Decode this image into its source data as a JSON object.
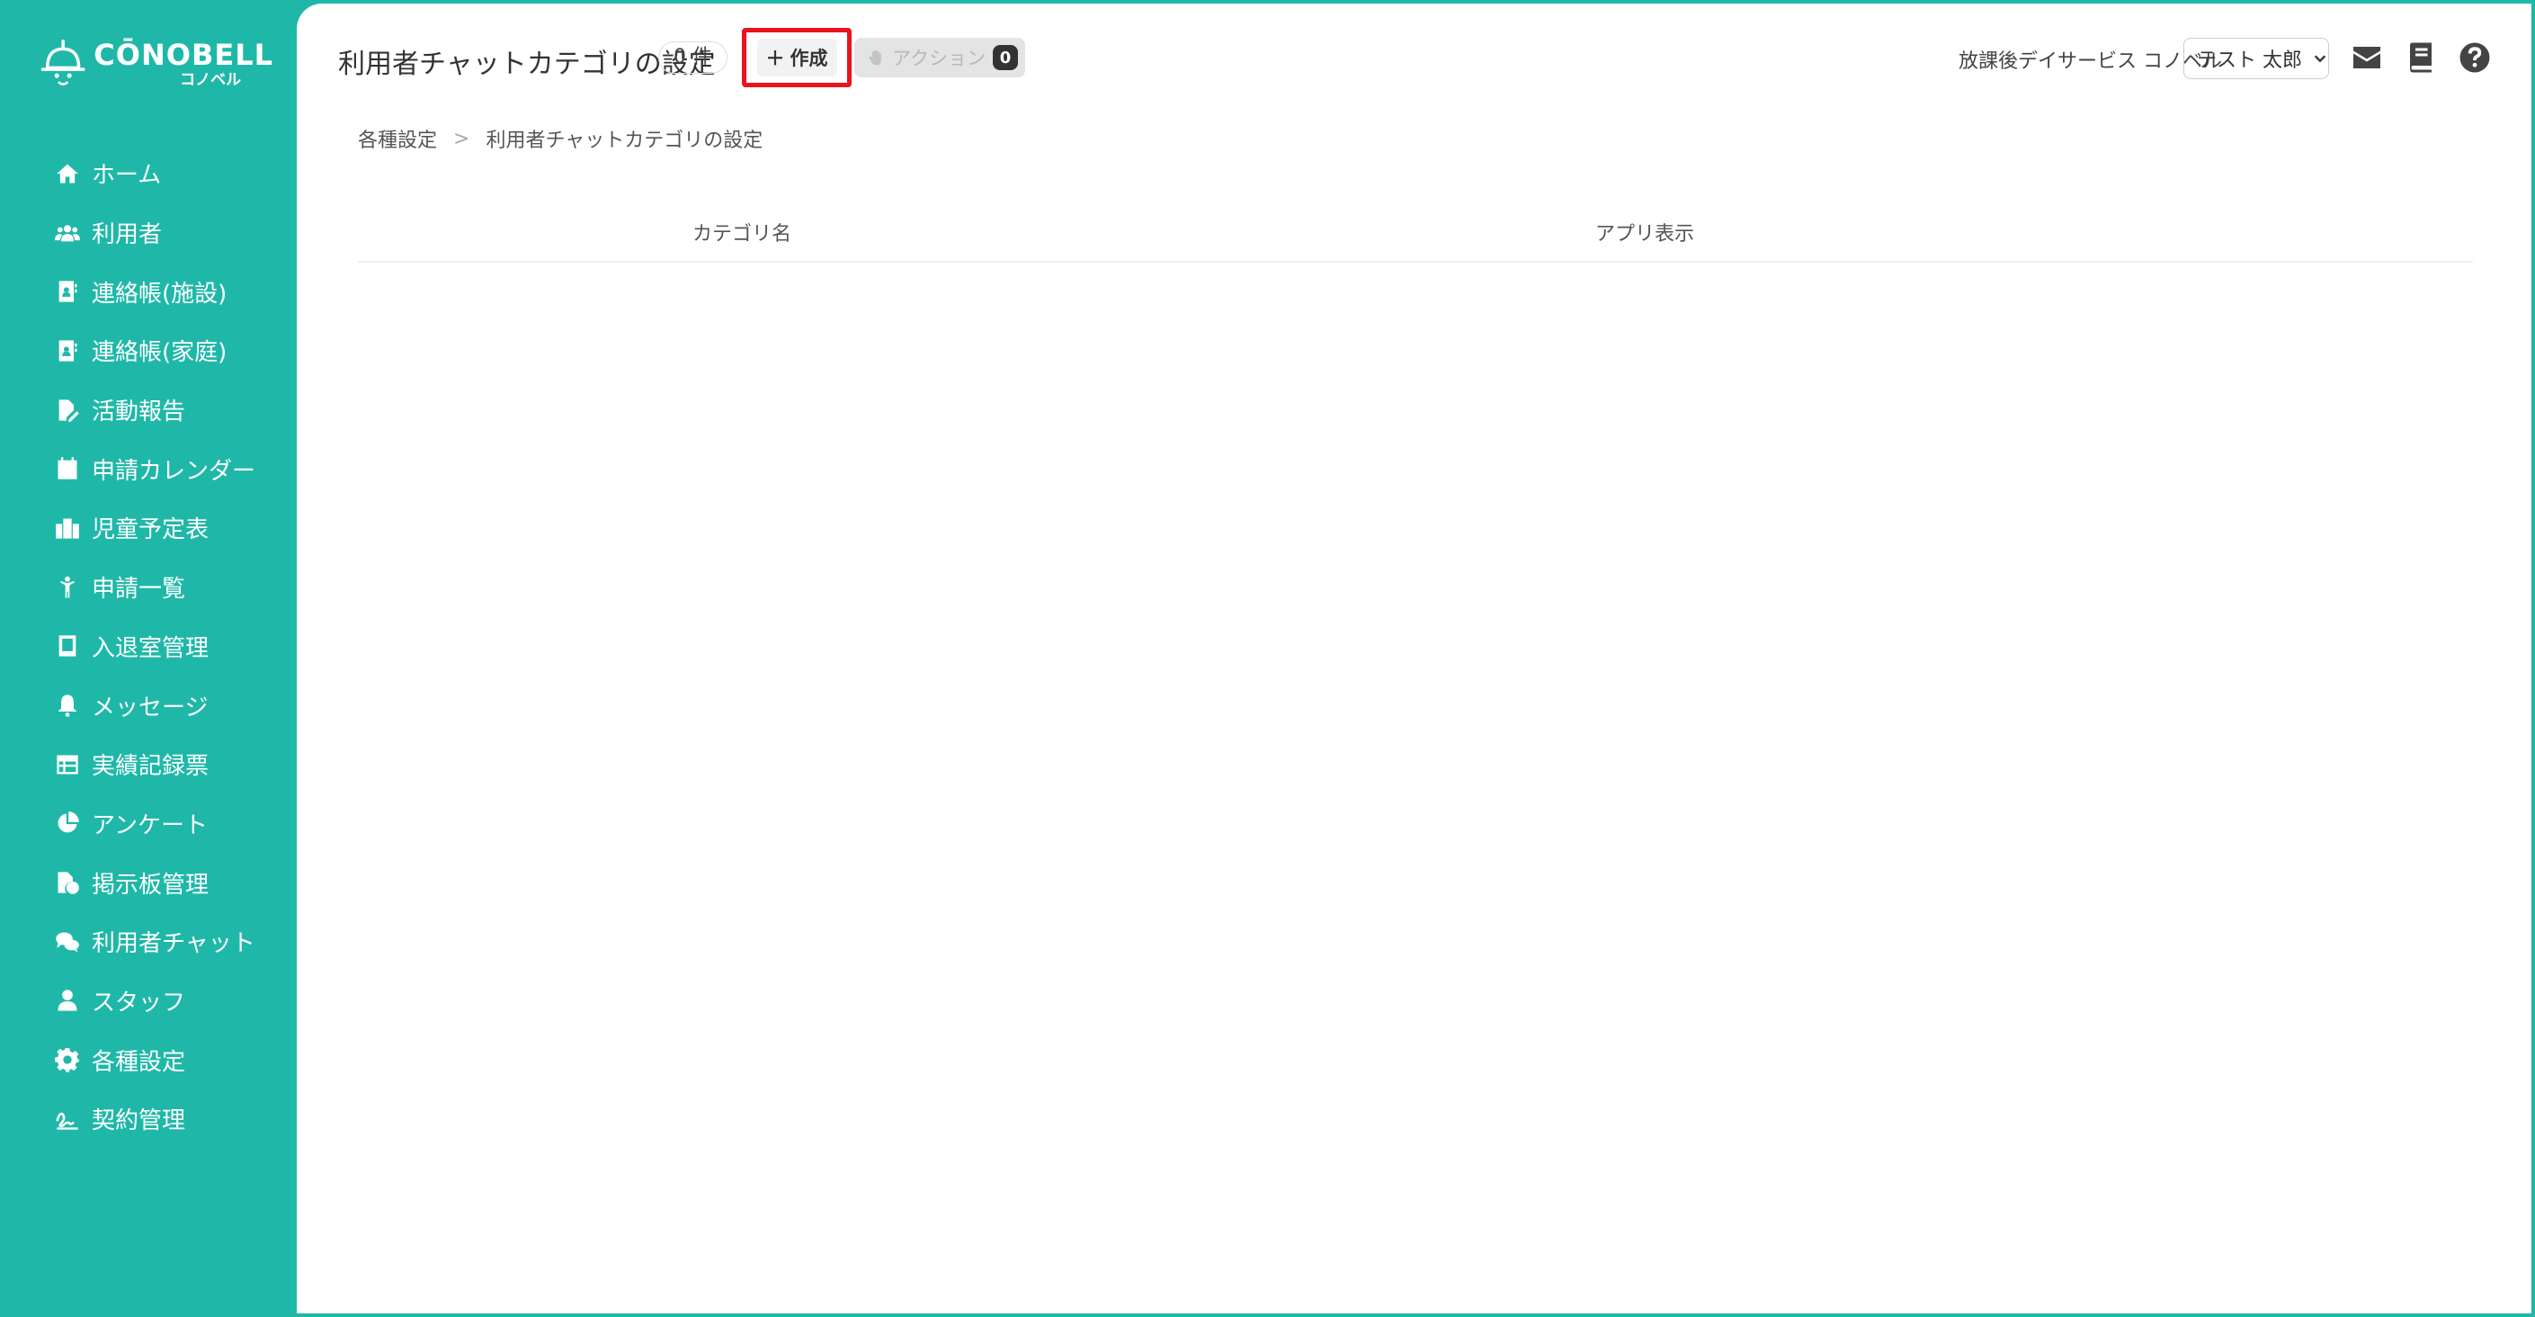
{
  "brand": {
    "name": "CŌNOBELL",
    "sub": "コノベル"
  },
  "sidebar": {
    "items": [
      {
        "label": "ホーム",
        "icon": "home-icon"
      },
      {
        "label": "利用者",
        "icon": "users-icon"
      },
      {
        "label": "連絡帳(施設)",
        "icon": "contact-book-icon"
      },
      {
        "label": "連絡帳(家庭)",
        "icon": "contact-book-icon"
      },
      {
        "label": "活動報告",
        "icon": "file-edit-icon"
      },
      {
        "label": "申請カレンダー",
        "icon": "calendar-icon"
      },
      {
        "label": "児童予定表",
        "icon": "building-icon"
      },
      {
        "label": "申請一覧",
        "icon": "child-icon"
      },
      {
        "label": "入退室管理",
        "icon": "tablet-icon"
      },
      {
        "label": "メッセージ",
        "icon": "bell-icon"
      },
      {
        "label": "実績記録票",
        "icon": "table-icon"
      },
      {
        "label": "アンケート",
        "icon": "pie-chart-icon"
      },
      {
        "label": "掲示板管理",
        "icon": "file-check-icon"
      },
      {
        "label": "利用者チャット",
        "icon": "chat-icon"
      },
      {
        "label": "スタッフ",
        "icon": "staff-icon"
      },
      {
        "label": "各種設定",
        "icon": "gear-icon"
      },
      {
        "label": "契約管理",
        "icon": "signature-icon"
      }
    ]
  },
  "header": {
    "title": "利用者チャットカテゴリの設定",
    "count": "0 件",
    "create_label": "作成",
    "action_label": "アクション",
    "action_count": "0",
    "facility": "放課後デイサービス コノベル",
    "user": "テスト 太郎"
  },
  "breadcrumb": {
    "parent": "各種設定",
    "sep": ">",
    "current": "利用者チャットカテゴリの設定"
  },
  "table": {
    "columns": [
      "カテゴリ名",
      "アプリ表示"
    ]
  },
  "colors": {
    "accent": "#1fb8a8",
    "highlight": "#e8141e"
  }
}
